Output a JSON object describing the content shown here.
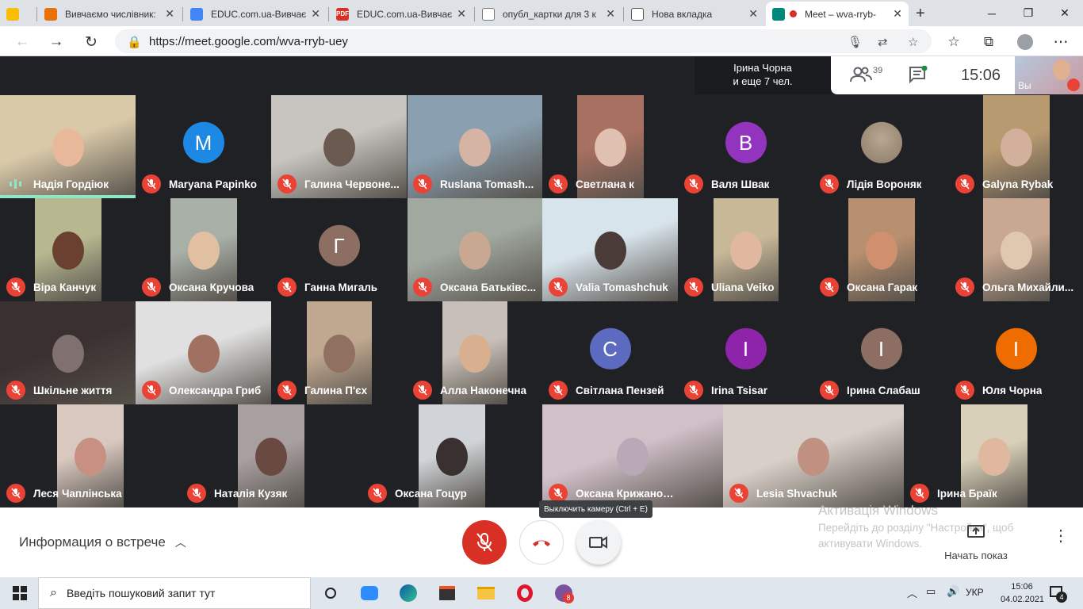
{
  "browser": {
    "tabs": [
      {
        "title": "",
        "fav_color": "#fbbc04"
      },
      {
        "title": "Вивчаємо числівник:",
        "fav_color": "#e8710a"
      },
      {
        "title": "EDUC.com.ua-Вивчає",
        "fav_color": "#4285f4"
      },
      {
        "title": "EDUC.com.ua-Вивчає",
        "fav_color": "#d93025"
      },
      {
        "title": "опубл_картки для 3 к",
        "fav_color": "#9aa0a6"
      },
      {
        "title": "Нова вкладка",
        "fav_color": "#5f6368"
      },
      {
        "title": "Meet – wva-rryb-",
        "fav_color": "#00897b",
        "active": true
      }
    ],
    "new_tab_symbol": "+",
    "url": "https://meet.google.com/wva-rryb-uey"
  },
  "meet": {
    "speaking_text": "Ірина Чорна",
    "speaking_more": "и еще 7 чел.",
    "participants_count": "39",
    "time": "15:06",
    "self_label": "Вы"
  },
  "participants": [
    {
      "name": "Надія Гордіюк",
      "kind": "video",
      "speaking": true,
      "colors": [
        "#d9c9a8",
        "#e8b89b"
      ]
    },
    {
      "name": "Maryana Papinko",
      "kind": "avatar",
      "letter": "M",
      "color": "#1e88e5"
    },
    {
      "name": "Галина Червоне...",
      "kind": "video",
      "colors": [
        "#c8c5c0",
        "#6a5a50"
      ]
    },
    {
      "name": "Ruslana Tomash...",
      "kind": "video",
      "colors": [
        "#8aa0b0",
        "#d6b4a4"
      ]
    },
    {
      "name": "Светлана к",
      "kind": "video",
      "colors": [
        "#a77060",
        "#e0c0b0"
      ]
    },
    {
      "name": "Валя Швак",
      "kind": "avatar",
      "letter": "B",
      "color": "#9334bf"
    },
    {
      "name": "Лідія Вороняк",
      "kind": "photo",
      "color": "#8a7a68"
    },
    {
      "name": "Galyna Rybak",
      "kind": "video",
      "colors": [
        "#b89a70",
        "#d2b09c"
      ]
    },
    {
      "name": "Віра Канчук",
      "kind": "video",
      "colors": [
        "#b8b890",
        "#6a4030"
      ]
    },
    {
      "name": "Оксана Кручова",
      "kind": "video",
      "colors": [
        "#a8b0a8",
        "#e0c0a0"
      ]
    },
    {
      "name": "Ганна Мигаль",
      "kind": "avatar",
      "letter": "Г",
      "color": "#8d6e63"
    },
    {
      "name": "Оксана Батьківс...",
      "kind": "video",
      "colors": [
        "#a0a8a0",
        "#c8a890"
      ]
    },
    {
      "name": "Valia Tomashchuk",
      "kind": "video",
      "colors": [
        "#d8e4ec",
        "#4a3a38"
      ]
    },
    {
      "name": "Uliana Veiko",
      "kind": "video",
      "colors": [
        "#c8b898",
        "#e0b8a0"
      ]
    },
    {
      "name": "Оксана Гарак",
      "kind": "video",
      "colors": [
        "#b89070",
        "#d09070"
      ]
    },
    {
      "name": "Ольга Михайли...",
      "kind": "video",
      "colors": [
        "#c8a890",
        "#e0c8b0"
      ]
    },
    {
      "name": "Шкільне життя",
      "kind": "video",
      "colors": [
        "#3a3030",
        "#807070"
      ]
    },
    {
      "name": "Олександра Гриб",
      "kind": "video",
      "colors": [
        "#e0e0e0",
        "#a07060"
      ]
    },
    {
      "name": "Галина П'єх",
      "kind": "video",
      "colors": [
        "#c0a890",
        "#907060"
      ]
    },
    {
      "name": "Алла Наконечна",
      "kind": "video",
      "colors": [
        "#c8c0b8",
        "#d8b090"
      ]
    },
    {
      "name": "Світлана Пензей",
      "kind": "avatar",
      "letter": "C",
      "color": "#5c6bc0"
    },
    {
      "name": "Irina Tsisar",
      "kind": "avatar",
      "letter": "I",
      "color": "#8e24aa"
    },
    {
      "name": "Ірина Слабаш",
      "kind": "avatar",
      "letter": "I",
      "color": "#8d6e63"
    },
    {
      "name": "Юля Чорна",
      "kind": "avatar",
      "letter": "I",
      "color": "#ef6c00"
    },
    {
      "name": "Леся Чаплінська",
      "kind": "video",
      "colors": [
        "#d8c8c0",
        "#c89080"
      ]
    },
    {
      "name": "Наталія Кузяк",
      "kind": "video",
      "colors": [
        "#a8a0a0",
        "#6a4a40"
      ]
    },
    {
      "name": "Оксана Гоцур",
      "kind": "video",
      "colors": [
        "#d0d4d8",
        "#3a3030"
      ]
    },
    {
      "name": "Оксана Крижановська",
      "kind": "video",
      "colors": [
        "#d0c0c8",
        "#b8a8b8"
      ]
    },
    {
      "name": "Lesia Shvachuk",
      "kind": "video",
      "colors": [
        "#d8cfc8",
        "#c09080"
      ]
    },
    {
      "name": "Ірина Браїк",
      "kind": "video",
      "colors": [
        "#d8d0b8",
        "#e0b8a0"
      ]
    }
  ],
  "controls": {
    "tooltip": "Выключить камеру (Ctrl + E)",
    "meeting_info": "Информация о встрече",
    "present_label": "Начать показ"
  },
  "watermark": {
    "line1": "Активація Windows",
    "line2": "Перейдіть до розділу \"Настройки\", щоб",
    "line3": "активувати Windows."
  },
  "taskbar": {
    "search_placeholder": "Введіть пошуковий запит тут",
    "language": "УКР",
    "time": "15:06",
    "date": "04.02.2021",
    "viber_badge": "8",
    "notifications": "4"
  }
}
